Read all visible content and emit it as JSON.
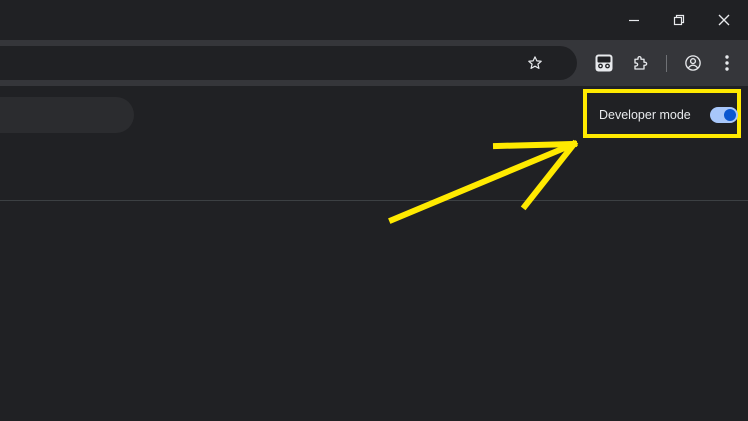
{
  "window": {
    "minimize_icon": "minimize-icon",
    "restore_icon": "restore-icon",
    "close_icon": "close-icon"
  },
  "toolbar": {
    "bookmark_icon": "star-icon",
    "extensions": [
      {
        "name": "tampermonkey-icon"
      },
      {
        "name": "puzzle-icon"
      }
    ],
    "profile_icon": "profile-icon",
    "menu_icon": "kebab-menu-icon"
  },
  "extensions_page": {
    "developer_mode_label": "Developer mode",
    "developer_mode_on": true
  },
  "annotation": {
    "highlight_color": "#ffea00"
  },
  "colors": {
    "background": "#202124",
    "toolbar": "#35363a",
    "toggle_track": "#a8c7fa",
    "toggle_knob": "#0b57d0"
  }
}
